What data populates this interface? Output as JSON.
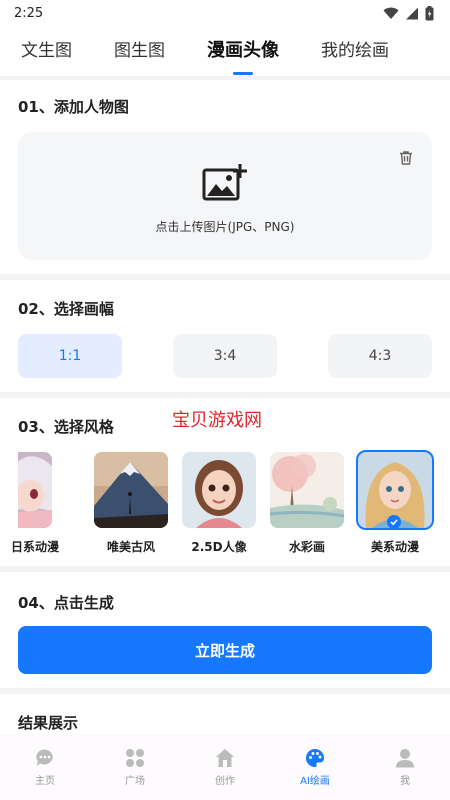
{
  "status": {
    "time": "2:25"
  },
  "tabs": [
    {
      "label": "文生图"
    },
    {
      "label": "图生图"
    },
    {
      "label": "漫画头像",
      "active": true
    },
    {
      "label": "我的绘画"
    }
  ],
  "upload_section": {
    "title": "01、添加人物图",
    "hint": "点击上传图片(JPG、PNG)"
  },
  "ratio_section": {
    "title": "02、选择画幅",
    "options": [
      {
        "label": "1:1",
        "selected": true
      },
      {
        "label": "3:4",
        "selected": false
      },
      {
        "label": "4:3",
        "selected": false
      }
    ]
  },
  "style_section": {
    "title": "03、选择风格",
    "watermark": "宝贝游戏网",
    "styles": [
      {
        "label": "日系动漫",
        "selected": false
      },
      {
        "label": "唯美古风",
        "selected": false
      },
      {
        "label": "2.5D人像",
        "selected": false
      },
      {
        "label": "水彩画",
        "selected": false
      },
      {
        "label": "美系动漫",
        "selected": true
      }
    ]
  },
  "generate_section": {
    "title": "04、点击生成",
    "button": "立即生成"
  },
  "result_section": {
    "title": "结果展示"
  },
  "bottom_nav": [
    {
      "label": "主页",
      "icon": "chat-bubble-icon"
    },
    {
      "label": "广场",
      "icon": "grid-icon"
    },
    {
      "label": "创作",
      "icon": "home-icon"
    },
    {
      "label": "AI绘画",
      "icon": "palette-icon",
      "active": true
    },
    {
      "label": "我",
      "icon": "person-icon"
    }
  ],
  "colors": {
    "accent": "#1677ff",
    "watermark": "#e0262d",
    "background": "#f2f3f5"
  }
}
